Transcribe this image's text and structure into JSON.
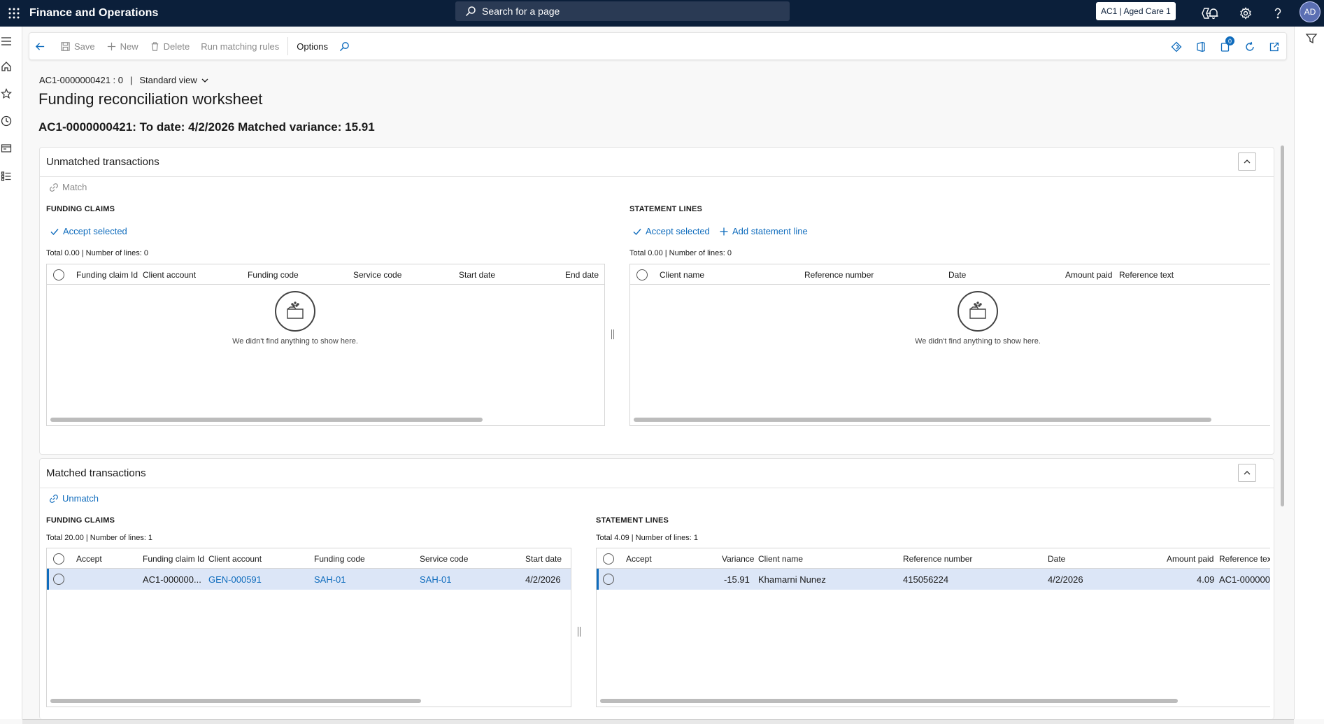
{
  "topbar": {
    "app_title": "Finance and Operations",
    "search_placeholder": "Search for a page",
    "company": "AC1 | Aged Care 1",
    "avatar_initials": "AD"
  },
  "actionpane": {
    "save": "Save",
    "new": "New",
    "delete": "Delete",
    "run_matching_rules": "Run matching rules",
    "options": "Options",
    "notification_count": "0"
  },
  "header": {
    "record_id": "AC1-0000000421 : 0",
    "view": "Standard view",
    "title": "Funding reconciliation worksheet",
    "subtitle": "AC1-0000000421: To date: 4/2/2026 Matched variance: 15.91"
  },
  "unmatched": {
    "title": "Unmatched transactions",
    "match_label": "Match",
    "funding_claims": {
      "label": "FUNDING CLAIMS",
      "accept_selected": "Accept selected",
      "totals": "Total 0.00 | Number of lines: 0",
      "columns": [
        "Funding claim Id",
        "Client account",
        "Funding code",
        "Service code",
        "Start date",
        "End date"
      ],
      "empty_text": "We didn't find anything to show here."
    },
    "statement_lines": {
      "label": "STATEMENT LINES",
      "accept_selected": "Accept selected",
      "add_statement_line": "Add statement line",
      "totals": "Total 0.00 | Number of lines: 0",
      "columns": [
        "Client name",
        "Reference number",
        "Date",
        "Amount paid",
        "Reference text"
      ],
      "empty_text": "We didn't find anything to show here."
    }
  },
  "matched": {
    "title": "Matched transactions",
    "unmatch_label": "Unmatch",
    "funding_claims": {
      "label": "FUNDING CLAIMS",
      "totals": "Total 20.00 | Number of lines: 1",
      "columns": [
        "Accept",
        "Funding claim Id",
        "Client account",
        "Funding code",
        "Service code",
        "Start date"
      ],
      "rows": [
        {
          "funding_claim_id": "AC1-000000...",
          "client_account": "GEN-000591",
          "funding_code": "SAH-01",
          "service_code": "SAH-01",
          "start_date": "4/2/2026"
        }
      ]
    },
    "statement_lines": {
      "label": "STATEMENT LINES",
      "totals": "Total 4.09 | Number of lines: 1",
      "columns": [
        "Accept",
        "Variance",
        "Client name",
        "Reference number",
        "Date",
        "Amount paid",
        "Reference text"
      ],
      "rows": [
        {
          "variance": "-15.91",
          "client_name": "Khamarni Nunez",
          "reference_number": "415056224",
          "date": "4/2/2026",
          "amount_paid": "4.09",
          "reference_text": "AC1-000000"
        }
      ]
    }
  },
  "icons": {
    "waffle": "app-launcher-icon",
    "search": "search-icon",
    "copilot": "copilot-icon",
    "bell": "notification-bell-icon",
    "settings": "gear-icon",
    "help": "help-icon",
    "filter": "filter-icon"
  },
  "colors": {
    "nav_background": "#0b1f3a",
    "accent": "#0f6cbd",
    "selected_row": "#dce6f7"
  }
}
